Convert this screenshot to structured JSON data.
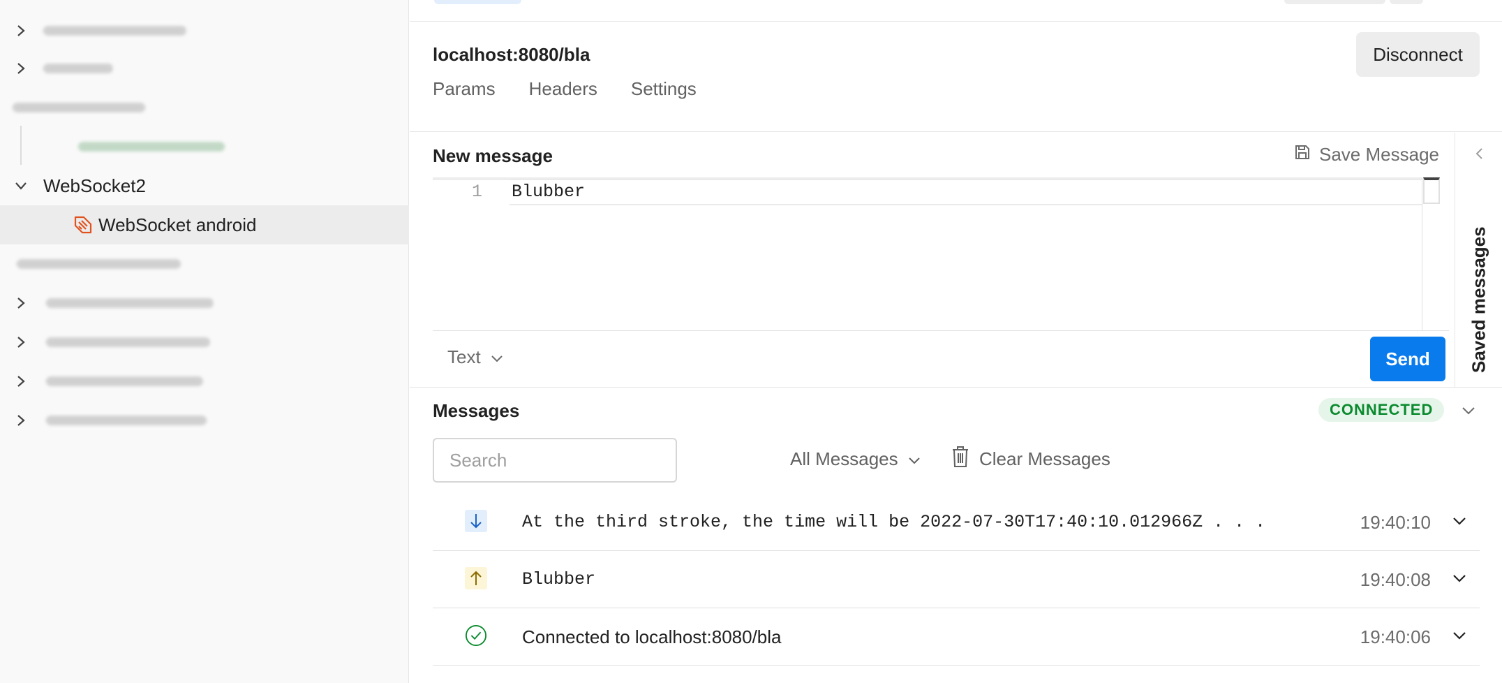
{
  "sidebar": {
    "items": [
      {
        "label": "WebSocket2",
        "expanded": true
      },
      {
        "label": "WebSocket android",
        "selected": true,
        "icon": "websocket-icon"
      }
    ]
  },
  "request": {
    "url": "localhost:8080/bla",
    "disconnect_label": "Disconnect",
    "tabs": [
      "Params",
      "Headers",
      "Settings"
    ]
  },
  "composer": {
    "title": "New message",
    "save_label": "Save Message",
    "line_number": "1",
    "content": "Blubber",
    "format": "Text",
    "send_label": "Send",
    "saved_messages_label": "Saved messages"
  },
  "messages": {
    "title": "Messages",
    "status": "CONNECTED",
    "search_placeholder": "Search",
    "filter": "All Messages",
    "clear_label": "Clear Messages",
    "items": [
      {
        "direction": "incoming",
        "icon": "arrow-down-icon",
        "text": "At the third stroke, the time will be 2022-07-30T17:40:10.012966Z . . .",
        "time": "19:40:10"
      },
      {
        "direction": "outgoing",
        "icon": "arrow-up-icon",
        "text": "Blubber",
        "time": "19:40:08"
      },
      {
        "direction": "status",
        "icon": "check-circle-icon",
        "text": "Connected to localhost:8080/bla",
        "time": "19:40:06"
      }
    ]
  },
  "colors": {
    "accent": "#097bed",
    "connected_text": "#0a8a2e",
    "connected_bg": "#e6f5ea",
    "websocket_icon": "#e0531f"
  }
}
